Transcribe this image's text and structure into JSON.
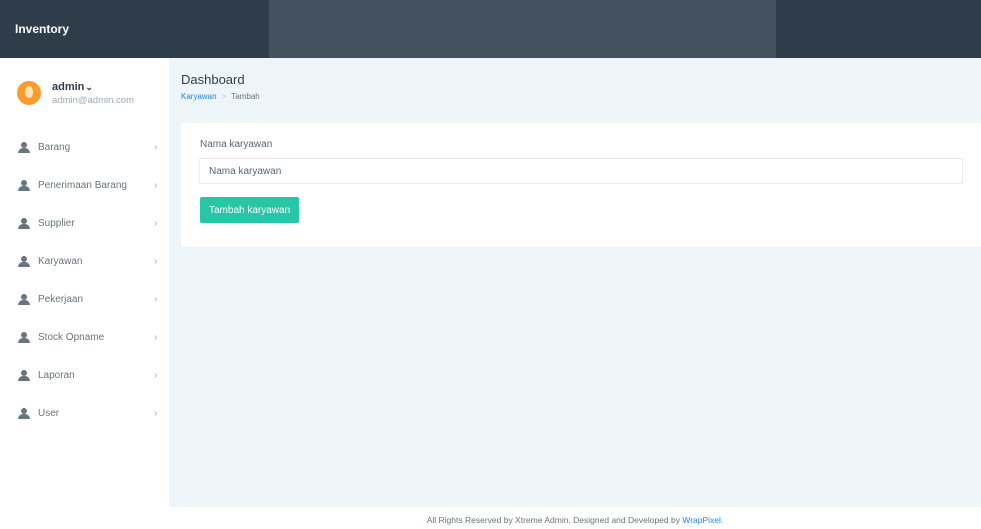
{
  "brand": {
    "title": "Inventory"
  },
  "profile": {
    "name": "admin",
    "caret": "⌄",
    "email": "admin@admin.com",
    "avatar_color": "#fb9c2c"
  },
  "sidebar": {
    "chevron": "›",
    "items": [
      {
        "label": "Barang",
        "icon": "user-icon"
      },
      {
        "label": "Penerimaan Barang",
        "icon": "user-icon"
      },
      {
        "label": "Supplier",
        "icon": "user-icon"
      },
      {
        "label": "Karyawan",
        "icon": "user-icon"
      },
      {
        "label": "Pekerjaan",
        "icon": "user-icon"
      },
      {
        "label": "Stock Opname",
        "icon": "user-icon"
      },
      {
        "label": "Laporan",
        "icon": "user-icon"
      },
      {
        "label": "User",
        "icon": "user-icon"
      }
    ]
  },
  "header": {
    "title": "Dashboard",
    "breadcrumb": {
      "parent": "Karyawan",
      "separator": ">",
      "current": "Tambah"
    }
  },
  "form": {
    "label": "Nama karyawan",
    "input_value": "",
    "input_placeholder": "Nama karyawan",
    "submit_label": "Tambah karyawan"
  },
  "footer": {
    "text": "All Rights Reserved by Xtreme Admin. Designed and Developed by ",
    "link": "WrapPixel",
    "suffix": "."
  },
  "colors": {
    "topbar": "#2f3d4a",
    "background": "#eef5f9",
    "accent_button": "#26c6a6",
    "link": "#1e88e5"
  }
}
